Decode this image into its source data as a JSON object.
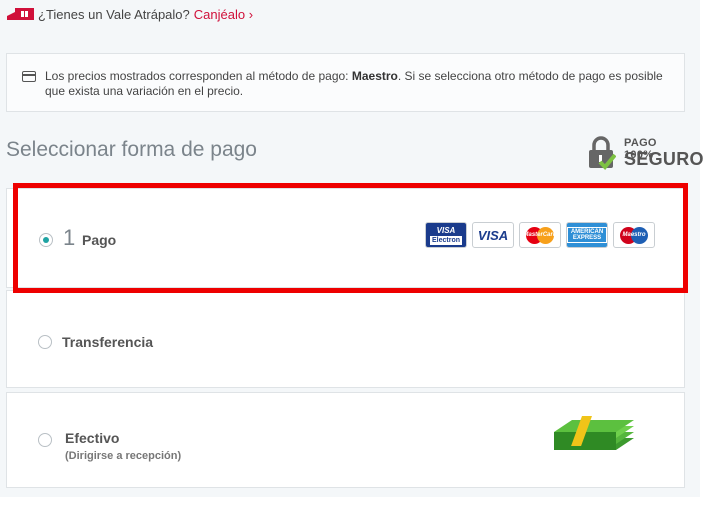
{
  "voucher": {
    "icon": "gift-ticket-icon",
    "question": "¿Tienes un Vale Atrápalo?",
    "link": "Canjéalo ›"
  },
  "info": {
    "icon": "credit-card-icon",
    "text_before": "Los precios mostrados corresponden al método de pago: ",
    "method": "Maestro",
    "text_after": ". Si se selecciona otro método de pago es posible que exista una variación en el precio."
  },
  "heading": "Seleccionar forma de pago",
  "secure_badge": {
    "icon": "lock-check-icon",
    "line1": "PAGO 100%",
    "line2": "SEGURO"
  },
  "options": [
    {
      "number": "1",
      "label": "Pago",
      "selected": true,
      "cards": [
        {
          "icon": "visa-electron-icon",
          "line1": "VISA",
          "line2": "Electron"
        },
        {
          "icon": "visa-icon",
          "text": "VISA"
        },
        {
          "icon": "mastercard-icon",
          "text": "MasterCard"
        },
        {
          "icon": "american-express-icon",
          "text": "AMERICAN EXPRESS"
        },
        {
          "icon": "maestro-icon",
          "text": "Maestro"
        }
      ]
    },
    {
      "label": "Transferencia",
      "selected": false
    },
    {
      "label": "Efectivo",
      "sublabel": "(Dirigirse a recepción)",
      "selected": false,
      "icon": "cash-money-icon"
    }
  ],
  "colors": {
    "accent_link": "#d0103a",
    "highlight": "#ee0000",
    "radio_selected": "#1fa3a3"
  }
}
